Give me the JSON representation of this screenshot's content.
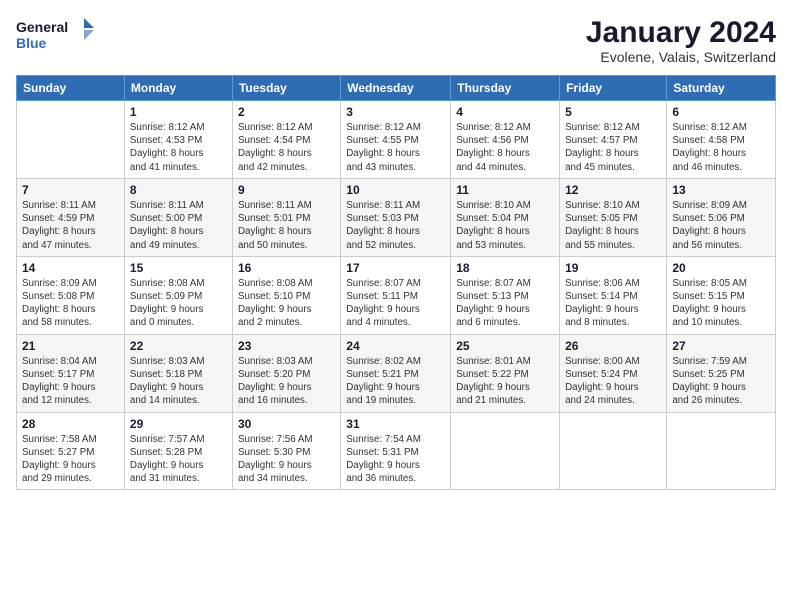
{
  "logo": {
    "line1": "General",
    "line2": "Blue"
  },
  "title": "January 2024",
  "subtitle": "Evolene, Valais, Switzerland",
  "days_of_week": [
    "Sunday",
    "Monday",
    "Tuesday",
    "Wednesday",
    "Thursday",
    "Friday",
    "Saturday"
  ],
  "weeks": [
    [
      {
        "day": "",
        "info": ""
      },
      {
        "day": "1",
        "info": "Sunrise: 8:12 AM\nSunset: 4:53 PM\nDaylight: 8 hours\nand 41 minutes."
      },
      {
        "day": "2",
        "info": "Sunrise: 8:12 AM\nSunset: 4:54 PM\nDaylight: 8 hours\nand 42 minutes."
      },
      {
        "day": "3",
        "info": "Sunrise: 8:12 AM\nSunset: 4:55 PM\nDaylight: 8 hours\nand 43 minutes."
      },
      {
        "day": "4",
        "info": "Sunrise: 8:12 AM\nSunset: 4:56 PM\nDaylight: 8 hours\nand 44 minutes."
      },
      {
        "day": "5",
        "info": "Sunrise: 8:12 AM\nSunset: 4:57 PM\nDaylight: 8 hours\nand 45 minutes."
      },
      {
        "day": "6",
        "info": "Sunrise: 8:12 AM\nSunset: 4:58 PM\nDaylight: 8 hours\nand 46 minutes."
      }
    ],
    [
      {
        "day": "7",
        "info": "Sunrise: 8:11 AM\nSunset: 4:59 PM\nDaylight: 8 hours\nand 47 minutes."
      },
      {
        "day": "8",
        "info": "Sunrise: 8:11 AM\nSunset: 5:00 PM\nDaylight: 8 hours\nand 49 minutes."
      },
      {
        "day": "9",
        "info": "Sunrise: 8:11 AM\nSunset: 5:01 PM\nDaylight: 8 hours\nand 50 minutes."
      },
      {
        "day": "10",
        "info": "Sunrise: 8:11 AM\nSunset: 5:03 PM\nDaylight: 8 hours\nand 52 minutes."
      },
      {
        "day": "11",
        "info": "Sunrise: 8:10 AM\nSunset: 5:04 PM\nDaylight: 8 hours\nand 53 minutes."
      },
      {
        "day": "12",
        "info": "Sunrise: 8:10 AM\nSunset: 5:05 PM\nDaylight: 8 hours\nand 55 minutes."
      },
      {
        "day": "13",
        "info": "Sunrise: 8:09 AM\nSunset: 5:06 PM\nDaylight: 8 hours\nand 56 minutes."
      }
    ],
    [
      {
        "day": "14",
        "info": "Sunrise: 8:09 AM\nSunset: 5:08 PM\nDaylight: 8 hours\nand 58 minutes."
      },
      {
        "day": "15",
        "info": "Sunrise: 8:08 AM\nSunset: 5:09 PM\nDaylight: 9 hours\nand 0 minutes."
      },
      {
        "day": "16",
        "info": "Sunrise: 8:08 AM\nSunset: 5:10 PM\nDaylight: 9 hours\nand 2 minutes."
      },
      {
        "day": "17",
        "info": "Sunrise: 8:07 AM\nSunset: 5:11 PM\nDaylight: 9 hours\nand 4 minutes."
      },
      {
        "day": "18",
        "info": "Sunrise: 8:07 AM\nSunset: 5:13 PM\nDaylight: 9 hours\nand 6 minutes."
      },
      {
        "day": "19",
        "info": "Sunrise: 8:06 AM\nSunset: 5:14 PM\nDaylight: 9 hours\nand 8 minutes."
      },
      {
        "day": "20",
        "info": "Sunrise: 8:05 AM\nSunset: 5:15 PM\nDaylight: 9 hours\nand 10 minutes."
      }
    ],
    [
      {
        "day": "21",
        "info": "Sunrise: 8:04 AM\nSunset: 5:17 PM\nDaylight: 9 hours\nand 12 minutes."
      },
      {
        "day": "22",
        "info": "Sunrise: 8:03 AM\nSunset: 5:18 PM\nDaylight: 9 hours\nand 14 minutes."
      },
      {
        "day": "23",
        "info": "Sunrise: 8:03 AM\nSunset: 5:20 PM\nDaylight: 9 hours\nand 16 minutes."
      },
      {
        "day": "24",
        "info": "Sunrise: 8:02 AM\nSunset: 5:21 PM\nDaylight: 9 hours\nand 19 minutes."
      },
      {
        "day": "25",
        "info": "Sunrise: 8:01 AM\nSunset: 5:22 PM\nDaylight: 9 hours\nand 21 minutes."
      },
      {
        "day": "26",
        "info": "Sunrise: 8:00 AM\nSunset: 5:24 PM\nDaylight: 9 hours\nand 24 minutes."
      },
      {
        "day": "27",
        "info": "Sunrise: 7:59 AM\nSunset: 5:25 PM\nDaylight: 9 hours\nand 26 minutes."
      }
    ],
    [
      {
        "day": "28",
        "info": "Sunrise: 7:58 AM\nSunset: 5:27 PM\nDaylight: 9 hours\nand 29 minutes."
      },
      {
        "day": "29",
        "info": "Sunrise: 7:57 AM\nSunset: 5:28 PM\nDaylight: 9 hours\nand 31 minutes."
      },
      {
        "day": "30",
        "info": "Sunrise: 7:56 AM\nSunset: 5:30 PM\nDaylight: 9 hours\nand 34 minutes."
      },
      {
        "day": "31",
        "info": "Sunrise: 7:54 AM\nSunset: 5:31 PM\nDaylight: 9 hours\nand 36 minutes."
      },
      {
        "day": "",
        "info": ""
      },
      {
        "day": "",
        "info": ""
      },
      {
        "day": "",
        "info": ""
      }
    ]
  ]
}
